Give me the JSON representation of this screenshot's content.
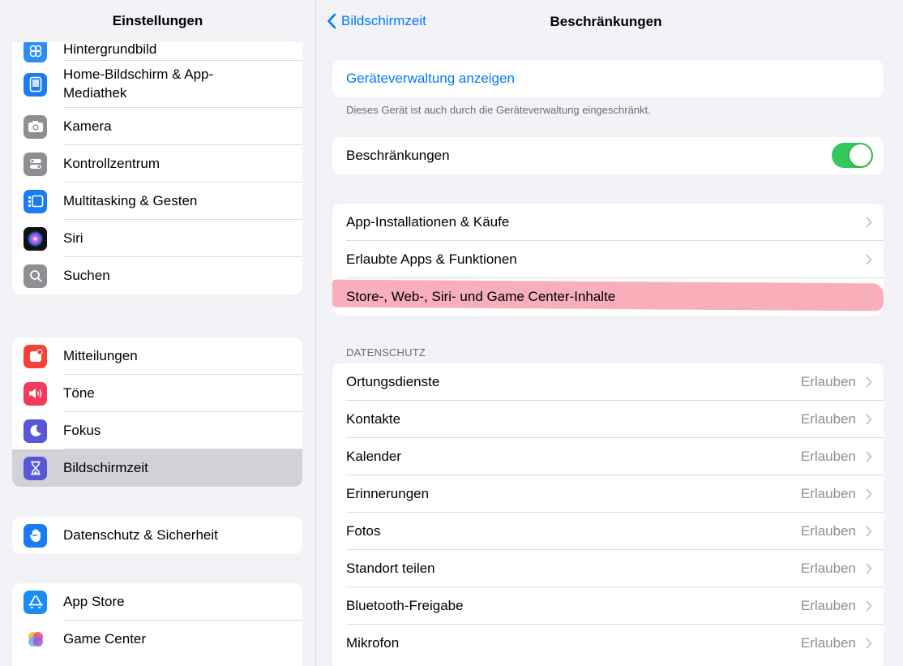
{
  "sidebar": {
    "title": "Einstellungen",
    "group1": [
      {
        "label": "Hintergrundbild",
        "icon": "wallpaper-icon",
        "color": "#2f8cf5"
      },
      {
        "label": "Home-Bildschirm & App-",
        "label2": "Mediathek",
        "icon": "home-screen-icon",
        "color": "#1a7cf5"
      },
      {
        "label": "Kamera",
        "icon": "camera-icon",
        "color": "#8e8e93"
      },
      {
        "label": "Kontrollzentrum",
        "icon": "control-center-icon",
        "color": "#8e8e93"
      },
      {
        "label": "Multitasking & Gesten",
        "icon": "multitasking-icon",
        "color": "#1a7cf5"
      },
      {
        "label": "Siri",
        "icon": "siri-icon",
        "color": "#1b1b3a"
      },
      {
        "label": "Suchen",
        "icon": "search-icon",
        "color": "#8e8e93"
      }
    ],
    "group2": [
      {
        "label": "Mitteilungen",
        "icon": "notifications-icon",
        "color": "#f44336"
      },
      {
        "label": "Töne",
        "icon": "sounds-icon",
        "color": "#f23a5b"
      },
      {
        "label": "Fokus",
        "icon": "focus-moon-icon",
        "color": "#5856d6"
      },
      {
        "label": "Bildschirmzeit",
        "icon": "hourglass-icon",
        "color": "#5856d6"
      }
    ],
    "group3": [
      {
        "label": "Datenschutz & Sicherheit",
        "icon": "privacy-hand-icon",
        "color": "#1a7cf5"
      }
    ],
    "group4": [
      {
        "label": "App Store",
        "icon": "app-store-icon",
        "color": "#1a8cf5"
      },
      {
        "label": "Game Center",
        "icon": "game-center-icon",
        "color": "#ffffff"
      }
    ]
  },
  "nav": {
    "back_label": "Bildschirmzeit",
    "title": "Beschränkungen"
  },
  "device_management": {
    "link_label": "Geräteverwaltung anzeigen",
    "footnote": "Dieses Gerät ist auch durch die Geräteverwaltung eingeschränkt."
  },
  "restrictions": {
    "label": "Beschränkungen",
    "enabled": true,
    "accent": "#34c759"
  },
  "menu": [
    {
      "label": "App-Installationen & Käufe"
    },
    {
      "label": "Erlaubte Apps & Funktionen"
    },
    {
      "label": "Store-, Web-, Siri- und Game Center-Inhalte",
      "highlighted": true
    }
  ],
  "privacy": {
    "header": "DATENSCHUTZ",
    "rows": [
      {
        "label": "Ortungsdienste",
        "value": "Erlauben"
      },
      {
        "label": "Kontakte",
        "value": "Erlauben"
      },
      {
        "label": "Kalender",
        "value": "Erlauben"
      },
      {
        "label": "Erinnerungen",
        "value": "Erlauben"
      },
      {
        "label": "Fotos",
        "value": "Erlauben"
      },
      {
        "label": "Standort teilen",
        "value": "Erlauben"
      },
      {
        "label": "Bluetooth-Freigabe",
        "value": "Erlauben"
      },
      {
        "label": "Mikrofon",
        "value": "Erlauben"
      }
    ]
  }
}
